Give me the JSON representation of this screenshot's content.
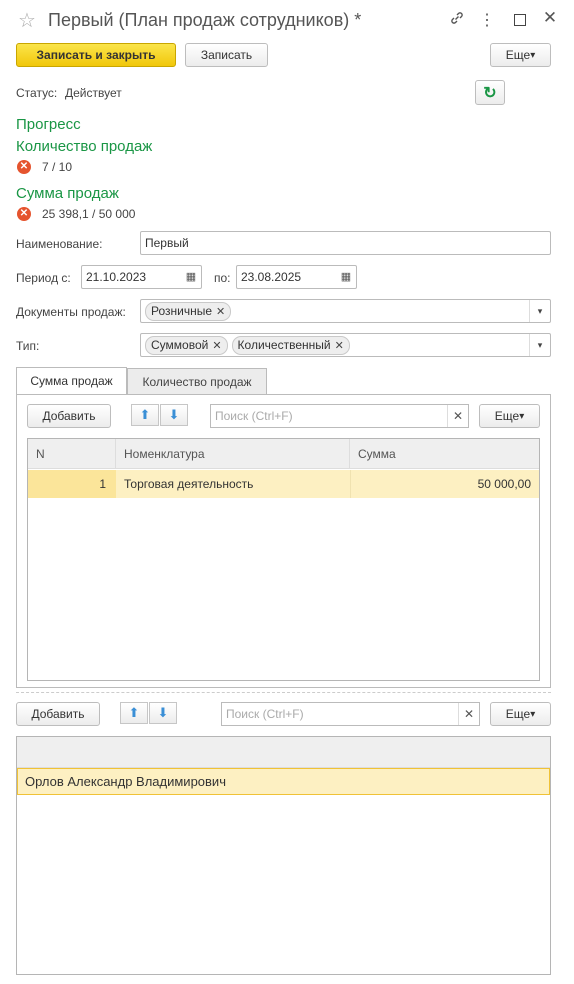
{
  "window": {
    "title": "Первый (План продаж сотрудников) *"
  },
  "toolbar": {
    "save_close_label": "Записать и закрыть",
    "save_label": "Записать",
    "more_label": "Еще"
  },
  "status": {
    "label": "Статус:",
    "value": "Действует"
  },
  "progress": {
    "heading": "Прогресс",
    "count_heading": "Количество продаж",
    "count_value": "7 / 10",
    "sum_heading": "Сумма продаж",
    "sum_value": "25 398,1 / 50 000"
  },
  "form": {
    "name_label": "Наименование:",
    "name_value": "Первый",
    "period_from_label": "Период с:",
    "period_from_value": "21.10.2023",
    "period_to_label": "по:",
    "period_to_value": "23.08.2025",
    "docs_label": "Документы продаж:",
    "docs_tags": [
      "Розничные"
    ],
    "type_label": "Тип:",
    "type_tags": [
      "Суммовой",
      "Количественный"
    ]
  },
  "tabs": [
    {
      "label": "Сумма продаж",
      "active": true
    },
    {
      "label": "Количество продаж",
      "active": false
    }
  ],
  "table1": {
    "add_label": "Добавить",
    "search_placeholder": "Поиск (Ctrl+F)",
    "more_label": "Еще",
    "columns": [
      "N",
      "Номенклатура",
      "Сумма"
    ],
    "rows": [
      {
        "n": "1",
        "item": "Торговая деятельность",
        "sum": "50 000,00"
      }
    ]
  },
  "table2": {
    "add_label": "Добавить",
    "search_placeholder": "Поиск (Ctrl+F)",
    "more_label": "Еще",
    "rows": [
      {
        "name": "Орлов Александр Владимирович"
      }
    ]
  },
  "colors": {
    "accent_green": "#1a9645",
    "primary_button": "#f1c70b",
    "selected_row": "#fdf0c2",
    "error_icon": "#e5542e"
  }
}
